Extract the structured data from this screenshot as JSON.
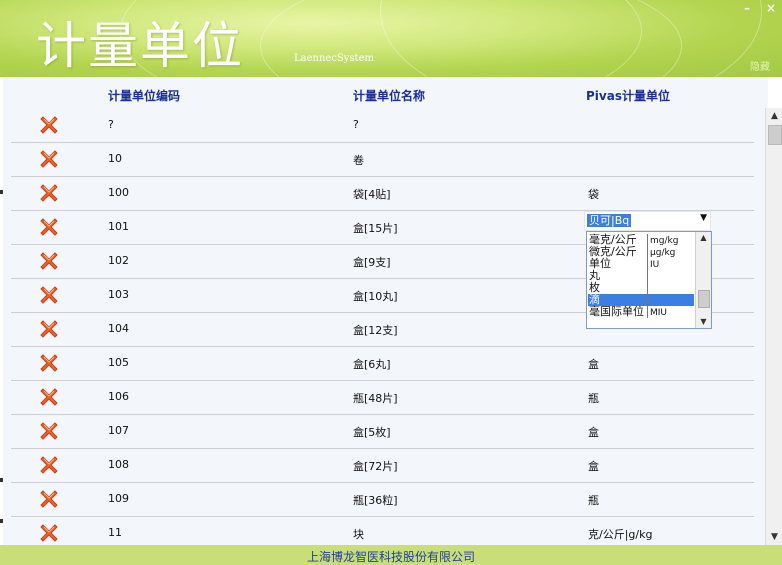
{
  "header": {
    "title": "计量单位",
    "subtitle": "LaennecSystem",
    "minimize": "–",
    "close": "×",
    "corner_text": "隐藏"
  },
  "grid": {
    "columns": [
      "计量单位编码",
      "计量单位名称",
      "Pivas计量单位"
    ],
    "rows": [
      {
        "code": "?",
        "name": "?",
        "pivas": ""
      },
      {
        "code": "10",
        "name": "卷",
        "pivas": ""
      },
      {
        "code": "100",
        "name": "袋[4贴]",
        "pivas": "袋"
      },
      {
        "code": "101",
        "name": "盒[15片]",
        "pivas": ""
      },
      {
        "code": "102",
        "name": "盒[9支]",
        "pivas": ""
      },
      {
        "code": "103",
        "name": "盒[10丸]",
        "pivas": ""
      },
      {
        "code": "104",
        "name": "盒[12支]",
        "pivas": ""
      },
      {
        "code": "105",
        "name": "盒[6丸]",
        "pivas": "盒"
      },
      {
        "code": "106",
        "name": "瓶[48片]",
        "pivas": "瓶"
      },
      {
        "code": "107",
        "name": "盒[5枚]",
        "pivas": "盒"
      },
      {
        "code": "108",
        "name": "盒[72片]",
        "pivas": "盒"
      },
      {
        "code": "109",
        "name": "瓶[36粒]",
        "pivas": "瓶"
      },
      {
        "code": "11",
        "name": "块",
        "pivas": "克/公斤|g/kg"
      },
      {
        "code": "",
        "name": "",
        "pivas": ""
      }
    ],
    "delete_icon": "delete-x-icon"
  },
  "select": {
    "value": "贝可|Bq",
    "options": [
      {
        "name": "毫克/公斤",
        "unit": "mg/kg"
      },
      {
        "name": "微克/公斤",
        "unit": "μg/kg"
      },
      {
        "name": "单位",
        "unit": "IU"
      },
      {
        "name": "丸",
        "unit": ""
      },
      {
        "name": "枚",
        "unit": ""
      },
      {
        "name": "滴",
        "unit": ""
      },
      {
        "name": "毫国际单位",
        "unit": "MIU"
      }
    ],
    "selected_index": 5
  },
  "footer": {
    "company": "上海博龙智医科技股份有限公司"
  },
  "colors": {
    "header": "#b2d44f",
    "grid_bg": "#f3f7fb",
    "column_header": "#1a2f9a",
    "selection": "#3d7fe0",
    "delete_icon": "#e0561c",
    "footer": "#c9dd78"
  }
}
